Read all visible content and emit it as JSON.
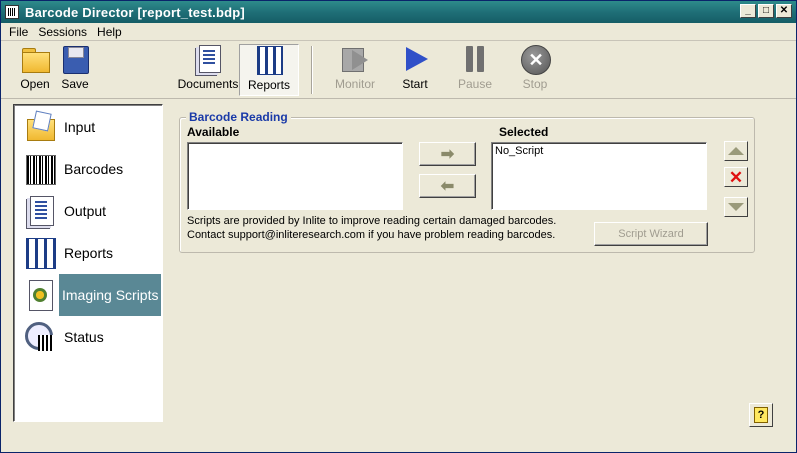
{
  "window": {
    "title": "Barcode Director  [report_test.bdp]"
  },
  "menu": [
    "File",
    "Sessions",
    "Help"
  ],
  "toolbar": {
    "open": "Open",
    "save": "Save",
    "documents": "Documents",
    "reports": "Reports",
    "monitor": "Monitor",
    "start": "Start",
    "pause": "Pause",
    "stop": "Stop"
  },
  "sidebar": {
    "items": [
      {
        "label": "Input",
        "icon": "input-folder-icon"
      },
      {
        "label": "Barcodes",
        "icon": "barcode-icon"
      },
      {
        "label": "Output",
        "icon": "output-document-icon"
      },
      {
        "label": "Reports",
        "icon": "reports-icon"
      },
      {
        "label": "Imaging Scripts",
        "icon": "imaging-scripts-icon",
        "selected": true
      },
      {
        "label": "Status",
        "icon": "status-magnifier-icon"
      }
    ]
  },
  "panel": {
    "group_title": "Barcode Reading",
    "available_label": "Available",
    "selected_label": "Selected",
    "available_items": [],
    "selected_items": [
      "No_Script"
    ],
    "note_line1": "Scripts are provided by Inlite to improve reading certain damaged barcodes.",
    "note_line2": "Contact support@inliteresearch.com if you have problem reading barcodes.",
    "script_wizard": "Script Wizard",
    "help_glyph": "?"
  },
  "colors": {
    "title_bar": "#1f6f77",
    "selection": "#5a8895",
    "group_title": "#1a3aa8",
    "delete_red": "#e01010",
    "start_blue": "#3050c8"
  }
}
